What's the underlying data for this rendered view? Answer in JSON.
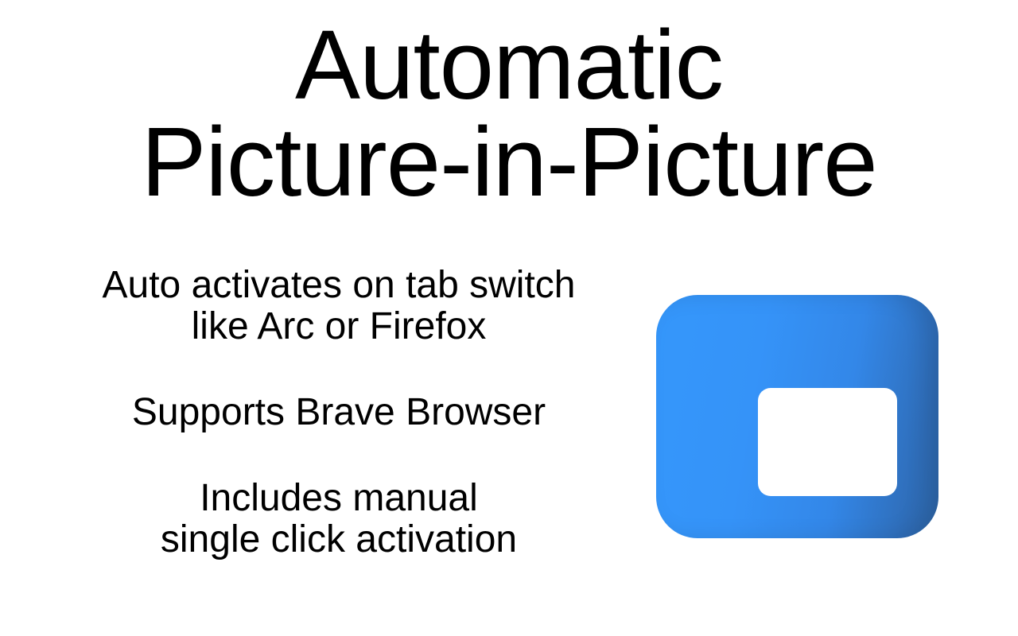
{
  "title": {
    "line1": "Automatic",
    "line2": "Picture-in-Picture"
  },
  "features": [
    {
      "line1": "Auto activates on tab switch",
      "line2": "like Arc or Firefox"
    },
    {
      "line1": "Supports Brave Browser"
    },
    {
      "line1": "Includes manual",
      "line2": "single click activation"
    }
  ],
  "icon": {
    "name": "picture-in-picture-icon",
    "colors": {
      "primary": "#3597fb",
      "edge": "#2d66a8",
      "window": "#ffffff"
    }
  }
}
